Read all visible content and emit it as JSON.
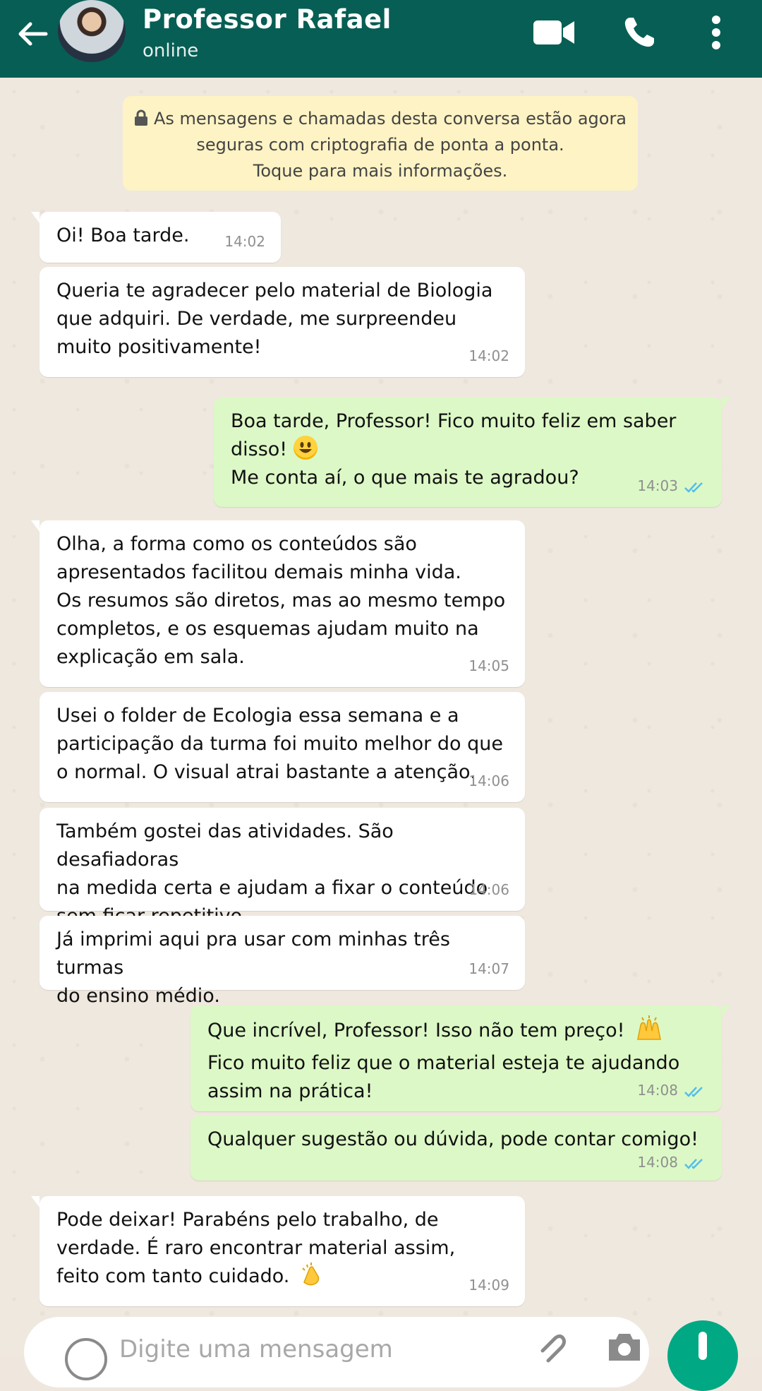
{
  "header": {
    "contact_name": "Professor Rafael",
    "status": "online",
    "icons": [
      "back-arrow-icon",
      "video-call-icon",
      "phone-icon",
      "more-vert-icon"
    ],
    "color": "#075e54"
  },
  "notice": {
    "line1": "As mensagens e chamadas desta conversa estão agora",
    "line2": "seguras com criptografia de ponta a ponta.",
    "line3": "Toque para mais informações."
  },
  "messages": [
    {
      "dir": "in",
      "lines": [
        "Oi! Boa tarde."
      ],
      "time": "14:02"
    },
    {
      "dir": "in",
      "lines": [
        "Queria te agradecer pelo material de Biologia",
        "que adquiri. De verdade, me surpreendeu",
        "muito positivamente!"
      ],
      "time": "14:02"
    },
    {
      "dir": "out",
      "lines": [
        "Boa tarde, Professor! Fico muito feliz em saber",
        "disso!",
        "Me conta aí, o que mais te agradou?"
      ],
      "time": "14:03"
    },
    {
      "dir": "in",
      "lines": [
        "Olha, a forma como os conteúdos são",
        "apresentados facilitou demais minha vida.",
        "Os resumos são diretos, mas ao mesmo tempo",
        "completos, e os esquemas ajudam muito na",
        "explicação em sala."
      ],
      "time": "14:05"
    },
    {
      "dir": "in",
      "lines": [
        "Usei o folder de Ecologia essa semana e a",
        "participação da turma foi muito melhor do que",
        "o normal. O visual atrai bastante a atenção."
      ],
      "time": "14:06"
    },
    {
      "dir": "in",
      "lines": [
        "Também gostei das atividades. São desafiadoras",
        "na medida certa e ajudam a fixar o conteúdo",
        "sem ficar repetitivo."
      ],
      "time": "14:06"
    },
    {
      "dir": "in",
      "lines": [
        "Já imprimi aqui pra usar com minhas três turmas",
        "do ensino médio."
      ],
      "time": "14:07"
    },
    {
      "dir": "out",
      "lines": [
        "Que incrível, Professor! Isso não tem preço!",
        "Fico muito feliz que o material esteja te ajudando",
        "assim na prática!"
      ],
      "time": "14:08"
    },
    {
      "dir": "out",
      "lines": [
        "Qualquer sugestão ou dúvida, pode contar comigo!"
      ],
      "time": "14:08"
    },
    {
      "dir": "in",
      "lines": [
        "Pode deixar! Parabéns pelo trabalho, de",
        "verdade. É raro encontrar material assim,",
        "feito com tanto cuidado."
      ],
      "time": "14:09"
    }
  ],
  "input": {
    "placeholder": "Digite uma mensagem",
    "icons": [
      "emoji-icon",
      "attach-icon",
      "camera-icon",
      "mic-icon"
    ]
  },
  "colors": {
    "incoming_bubble": "#ffffff",
    "outgoing_bubble": "#dcf8c6",
    "read_ticks": "#53bdeb",
    "notice_bg": "#fdf3c4"
  }
}
